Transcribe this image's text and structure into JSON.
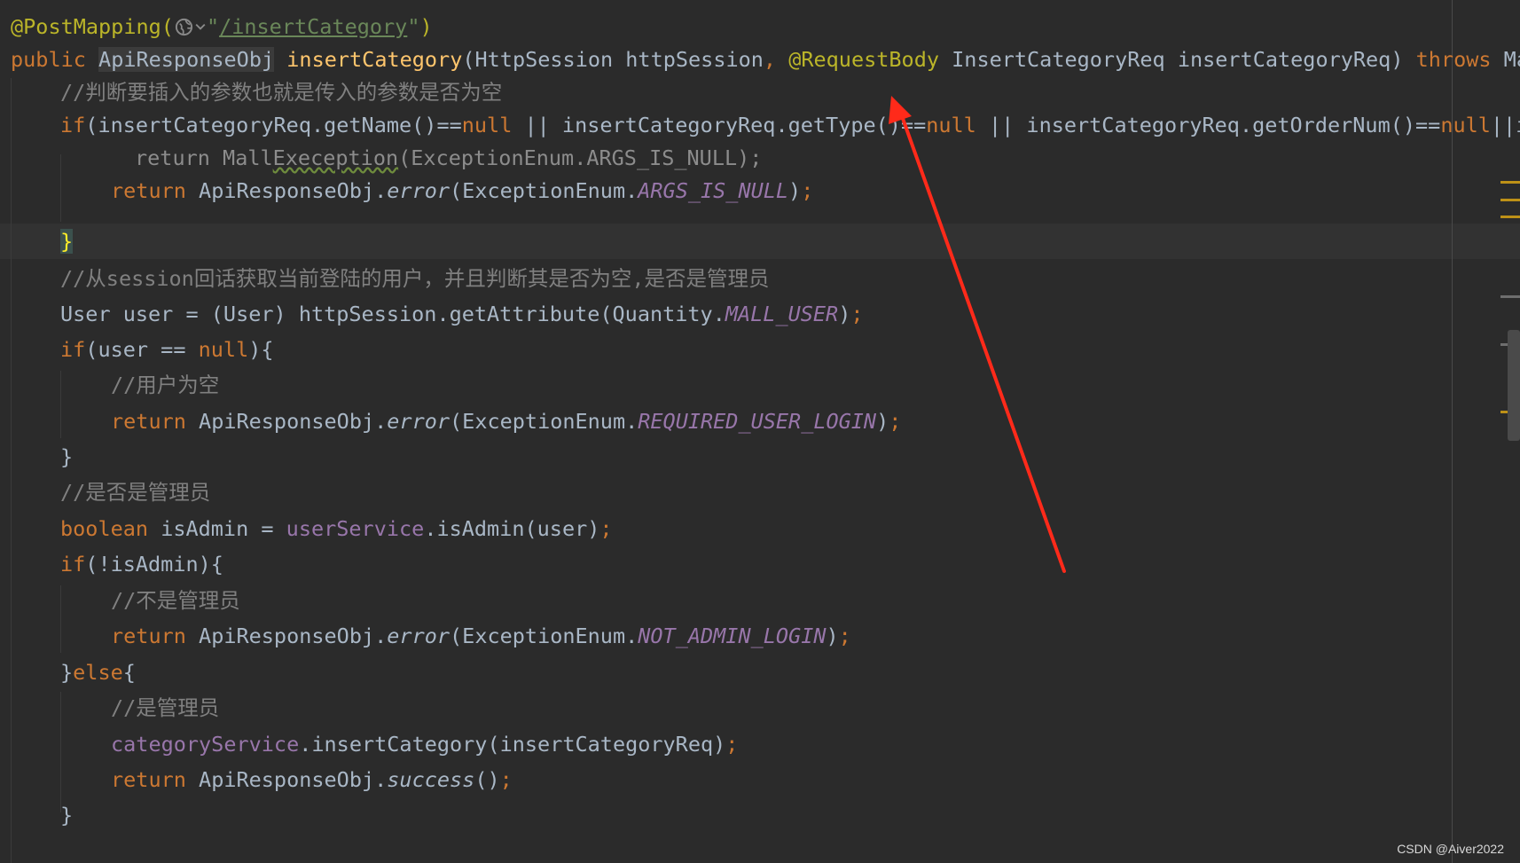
{
  "code": {
    "l1_annotation": "@PostMapping(",
    "l1_quote_open": "\"",
    "l1_path": "/insertCategory",
    "l1_quote_close": "\"",
    "l1_close_paren": ")",
    "l2_public": "public ",
    "l2_return_type": "ApiResponseObj",
    "l2_space": " ",
    "l2_method": "insertCategory",
    "l2_params_a": "(HttpSession httpSession",
    "l2_comma": ", ",
    "l2_request_body": "@RequestBody",
    "l2_params_b": " InsertCategoryReq insertCategoryReq) ",
    "l2_throws": "throws",
    "l2_tail": " Mal",
    "l3_comment": "//判断要插入的参数也就是传入的参数是否为空",
    "l4_if": "if",
    "l4_a": "(insertCategoryReq.getName()==",
    "l4_null1": "null",
    "l4_b": " || insertCategoryReq.getType()==",
    "l4_null2": "null",
    "l4_c": " || insertCategoryReq.getOrderNum()==",
    "l4_null3": "null",
    "l4_d": "||in",
    "l5_return": "return ",
    "l5_mall": "Mall",
    "l5_exeception": "Exeception",
    "l5_rest": "(ExceptionEnum.ARGS_IS_NULL);",
    "l6_return": "return ",
    "l6_obj": "ApiResponseObj.",
    "l6_error": "error",
    "l6_enum": "(ExceptionEnum.",
    "l6_const": "ARGS_IS_NULL",
    "l6_close": ")",
    "l6_semi": ";",
    "l7_brace": "}",
    "l8_comment": "//从session回话获取当前登陆的用户，并且判断其是否为空,是否是管理员",
    "l9_a": "User user = (User) httpSession.getAttribute(Quantity.",
    "l9_const": "MALL_USER",
    "l9_close": ")",
    "l9_semi": ";",
    "l10_if": "if",
    "l10_a": "(user == ",
    "l10_null": "null",
    "l10_b": "){",
    "l11_comment": "//用户为空",
    "l12_return": "return ",
    "l12_obj": "ApiResponseObj.",
    "l12_error": "error",
    "l12_enum": "(ExceptionEnum.",
    "l12_const": "REQUIRED_USER_LOGIN",
    "l12_close": ")",
    "l12_semi": ";",
    "l13_brace": "}",
    "l14_comment": "//是否是管理员",
    "l15_boolean": "boolean ",
    "l15_a": "isAdmin = ",
    "l15_field": "userService",
    "l15_b": ".isAdmin(user)",
    "l15_semi": ";",
    "l16_if": "if",
    "l16_a": "(!isAdmin){",
    "l17_comment": "//不是管理员",
    "l18_return": "return ",
    "l18_obj": "ApiResponseObj.",
    "l18_error": "error",
    "l18_enum": "(ExceptionEnum.",
    "l18_const": "NOT_ADMIN_LOGIN",
    "l18_close": ")",
    "l18_semi": ";",
    "l19_brace": "}",
    "l19_else": "else",
    "l19_open": "{",
    "l20_comment": "//是管理员",
    "l21_field": "categoryService",
    "l21_a": ".insertCategory(insertCategoryReq)",
    "l21_semi": ";",
    "l22_return": "return ",
    "l22_obj": "ApiResponseObj.",
    "l22_success": "success",
    "l22_paren": "()",
    "l22_semi": ";",
    "l23_brace": "}"
  },
  "icons": {
    "globe": "globe-icon",
    "chevron": "chevron-down-icon",
    "arrow": "red-arrow-annotation"
  },
  "colors": {
    "background": "#2b2b2b",
    "keyword": "#cc7832",
    "annotation": "#bbb529",
    "string": "#6a8759",
    "method": "#ffc66d",
    "comment": "#808080",
    "field": "#9876aa",
    "arrow": "#ff2a1a"
  },
  "watermark": "CSDN @Aiver2022"
}
